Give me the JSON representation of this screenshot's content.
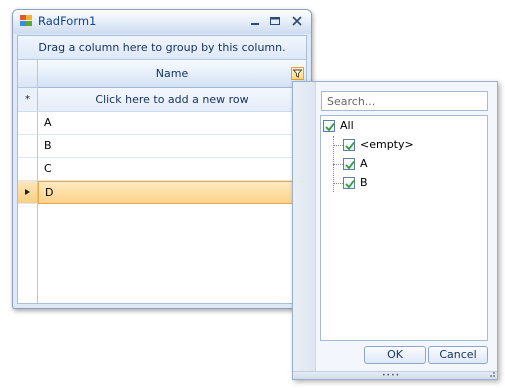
{
  "window": {
    "title": "RadForm1"
  },
  "grid": {
    "group_panel_text": "Drag a column here to group by this column.",
    "column_header": "Name",
    "new_row_text": "Click here to add a new row",
    "new_row_indicator": "*",
    "rows": [
      "A",
      "B",
      "C",
      "D"
    ],
    "current_row": "D"
  },
  "filter_popup": {
    "search_placeholder": "Search...",
    "tree": {
      "all_label": "All",
      "items": [
        "<empty>",
        "A",
        "B"
      ]
    },
    "ok_label": "OK",
    "cancel_label": "Cancel"
  },
  "colors": {
    "accent_selection": "#fbd38c",
    "title_text": "#15428b",
    "checkbox_check": "#3c9a34"
  }
}
